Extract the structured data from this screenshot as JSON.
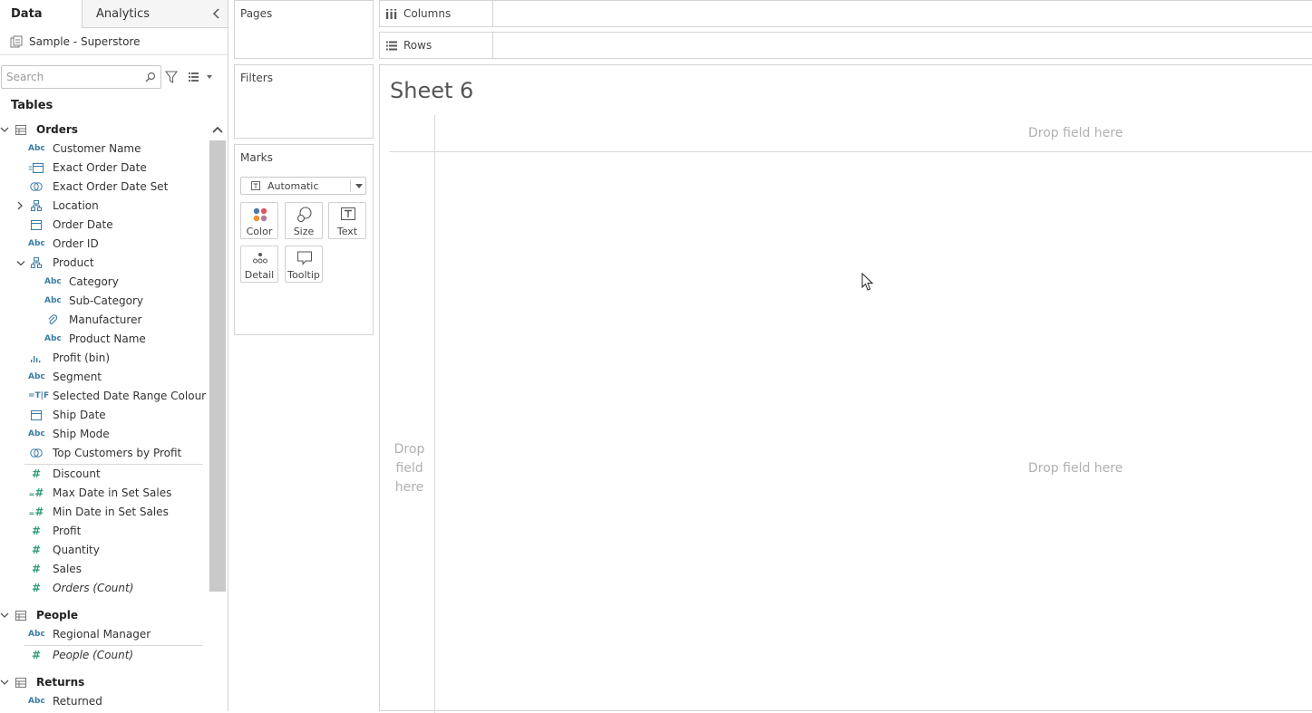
{
  "tabs": {
    "data": "Data",
    "analytics": "Analytics"
  },
  "data_source": {
    "name": "Sample - Superstore"
  },
  "search": {
    "placeholder": "Search"
  },
  "tables_heading": "Tables",
  "tables": {
    "orders": {
      "label": "Orders",
      "fields": [
        {
          "name": "Customer Name",
          "type": "Abc"
        },
        {
          "name": "Exact Order Date",
          "type": "=date"
        },
        {
          "name": "Exact Order Date Set",
          "type": "set"
        },
        {
          "name": "Location",
          "type": "hierarchy"
        },
        {
          "name": "Order Date",
          "type": "date"
        },
        {
          "name": "Order ID",
          "type": "Abc"
        },
        {
          "name": "Product",
          "type": "hierarchy"
        },
        {
          "name": "Category",
          "type": "Abc"
        },
        {
          "name": "Sub-Category",
          "type": "Abc"
        },
        {
          "name": "Manufacturer",
          "type": "group"
        },
        {
          "name": "Product Name",
          "type": "Abc"
        },
        {
          "name": "Profit (bin)",
          "type": "bin"
        },
        {
          "name": "Segment",
          "type": "Abc"
        },
        {
          "name": "Selected Date Range Colour",
          "type": "=T|F"
        },
        {
          "name": "Ship Date",
          "type": "date"
        },
        {
          "name": "Ship Mode",
          "type": "Abc"
        },
        {
          "name": "Top Customers by Profit",
          "type": "set"
        }
      ],
      "measures": [
        {
          "name": "Discount",
          "type": "#"
        },
        {
          "name": "Max Date in Set Sales",
          "type": "=#"
        },
        {
          "name": "Min Date in Set Sales",
          "type": "=#"
        },
        {
          "name": "Profit",
          "type": "#"
        },
        {
          "name": "Quantity",
          "type": "#"
        },
        {
          "name": "Sales",
          "type": "#"
        },
        {
          "name": "Orders (Count)",
          "type": "#"
        }
      ]
    },
    "people": {
      "label": "People",
      "fields": [
        {
          "name": "Regional Manager",
          "type": "Abc"
        }
      ],
      "measures": [
        {
          "name": "People (Count)",
          "type": "#"
        }
      ]
    },
    "returns": {
      "label": "Returns",
      "fields": [
        {
          "name": "Returned",
          "type": "Abc"
        }
      ]
    }
  },
  "icons": {
    "abc": "Abc"
  },
  "cards": {
    "pages": "Pages",
    "filters": "Filters",
    "marks": "Marks",
    "mark_type": "Automatic",
    "mark_buttons": {
      "color": "Color",
      "size": "Size",
      "text": "Text",
      "detail": "Detail",
      "tooltip": "Tooltip"
    }
  },
  "shelves": {
    "columns": "Columns",
    "rows": "Rows"
  },
  "sheet": {
    "title": "Sheet 6",
    "drop_top": "Drop field here",
    "drop_left_1": "Drop",
    "drop_left_2": "field",
    "drop_left_3": "here",
    "drop_main": "Drop field here"
  },
  "colors": {
    "dimension_icon": "#3a7ca5",
    "measure_icon": "#2f9c78",
    "border": "#d4d4d4",
    "placeholder_text": "#b0b0b0"
  }
}
